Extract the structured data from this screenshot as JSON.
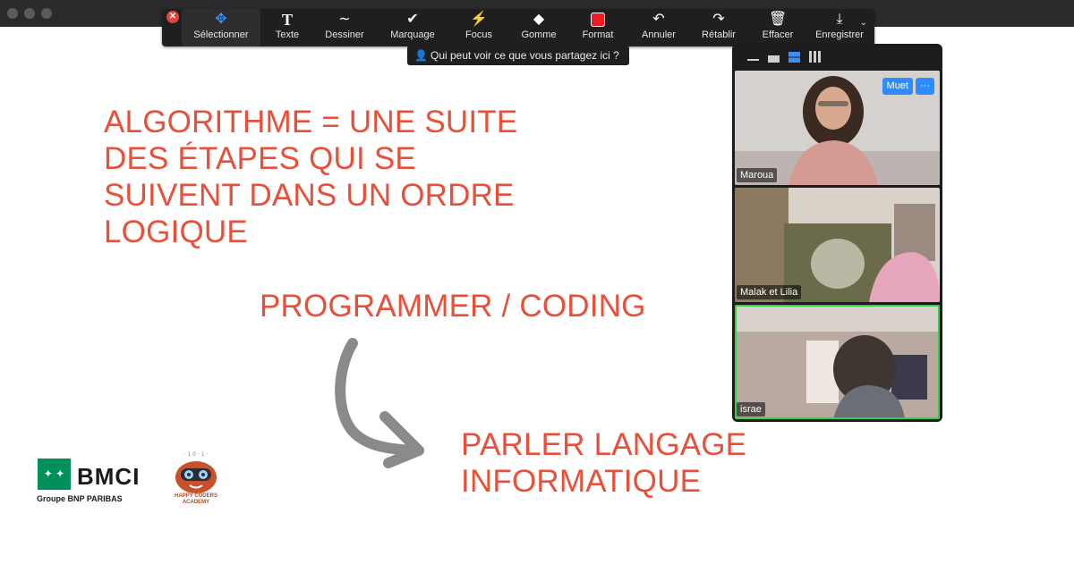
{
  "toolbar": {
    "close_icon": "close-icon",
    "tools": [
      {
        "label": "Sélectionner",
        "icon": "move-icon"
      },
      {
        "label": "Texte",
        "icon": "text-icon"
      },
      {
        "label": "Dessiner",
        "icon": "draw-icon"
      },
      {
        "label": "Marquage",
        "icon": "checkmark-icon"
      },
      {
        "label": "Focus",
        "icon": "spotlight-icon"
      },
      {
        "label": "Gomme",
        "icon": "eraser-icon"
      },
      {
        "label": "Format",
        "icon": "format-swatch-icon",
        "color": "#ec1c24"
      },
      {
        "label": "Annuler",
        "icon": "undo-icon"
      },
      {
        "label": "Rétablir",
        "icon": "redo-icon"
      },
      {
        "label": "Effacer",
        "icon": "trash-icon"
      },
      {
        "label": "Enregistrer",
        "icon": "save-icon"
      }
    ]
  },
  "share_hint": "Qui peut voir ce que vous partagez ici ?",
  "slide": {
    "line1": "ALGORITHME = UNE SUITE",
    "line2": "DES ÉTAPES QUI SE",
    "line3": "SUIVENT DANS UN ORDRE",
    "line4": "LOGIQUE",
    "programmer": "PROGRAMMER / CODING",
    "parler1": "PARLER LANGAGE",
    "parler2": "INFORMATIQUE",
    "text_color": "#e8503a"
  },
  "logos": {
    "bmci_name": "BMCI",
    "bmci_sub": "Groupe BNP PARIBAS",
    "happy_line1": "HAPPY CODERS",
    "happy_line2": "ACADEMY"
  },
  "video_panel": {
    "participants": [
      {
        "name": "Maroua",
        "mute_label": "Muet",
        "more_label": "···"
      },
      {
        "name": "Malak et Lilia"
      },
      {
        "name": "israe",
        "active_speaker": true
      }
    ]
  }
}
